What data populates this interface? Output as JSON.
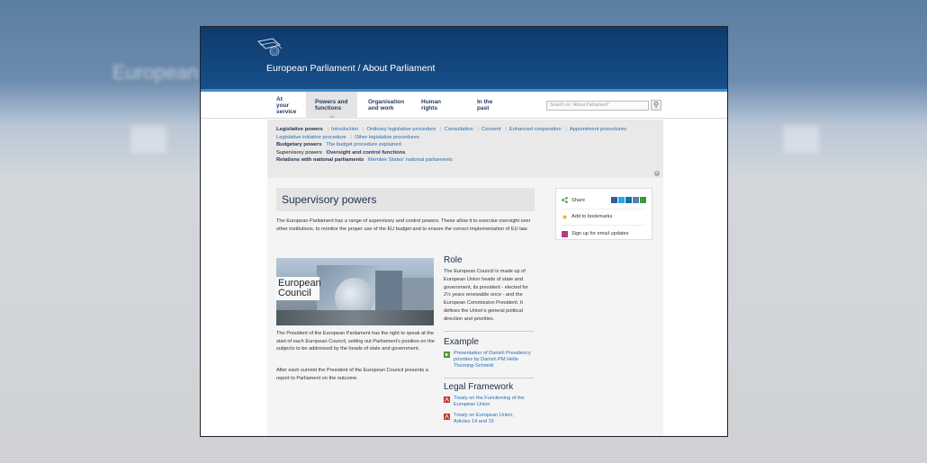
{
  "header": {
    "site_title": "European Parliament / About Parliament",
    "background_title": "European Pa",
    "colors": {
      "header_top": "#0e3a6b",
      "header_bottom": "#174f8a",
      "accent": "#3a8fd6"
    }
  },
  "nav": {
    "items": [
      {
        "label": "At your service"
      },
      {
        "label": "Powers and functions"
      },
      {
        "label": "Organisation and work"
      },
      {
        "label": "Human rights"
      },
      {
        "label": "In the past"
      }
    ],
    "search_placeholder": "Search on \"About Parliament\""
  },
  "submenu": {
    "legislative_heading": "Legislative powers",
    "legislative_links": [
      "Introduction",
      "Ordinary legislative procedure",
      "Consultation",
      "Consent",
      "Enhanced cooperation",
      "Appointment procedures"
    ],
    "legislative_links_2": [
      "Legislative initiative procedure",
      "Other legislative procedures"
    ],
    "budgetary_heading": "Budgetary powers",
    "budgetary_link": "The budget procedure explained",
    "supervisory_heading": "Supervisory powers",
    "supervisory_link": "Oversight and control functions",
    "relations_heading": "Relations with national parliaments",
    "relations_link": "Member States' national parliaments"
  },
  "main": {
    "title": "Supervisory powers",
    "intro": "The European Parliament has a range of supervisory and control powers. These allow it to exercise oversight over other institutions, to monitor the proper use of the EU budget and to ensure the correct implementation of EU law.",
    "photo_caption": "European Council",
    "para1": "The President of the European Parliament has the right to speak at the start of each European Council, setting out Parliament's position on the subjects to be addressed by the heads of state and government.",
    "para2": "After each summit the President of the European Council presents a report to Parliament on the outcome."
  },
  "role": {
    "heading": "Role",
    "text": "The European Council is made up of European Union heads of state and government, its president - elected for 2½ years renewable once - and the European Commission President. It defines the Union's general political direction and priorities."
  },
  "example": {
    "heading": "Example",
    "link": "Presentation of Danish Presidency priorities by Danish PM Helle Thorning-Schmidt"
  },
  "legal": {
    "heading": "Legal Framework",
    "links": [
      "Treaty on the Functioning of the European Union",
      "Treaty on European Union, Articles 14 and 15"
    ]
  },
  "sidebox": {
    "share": "Share",
    "bookmarks": "Add to bookmarks",
    "email": "Sign up for email updates"
  }
}
